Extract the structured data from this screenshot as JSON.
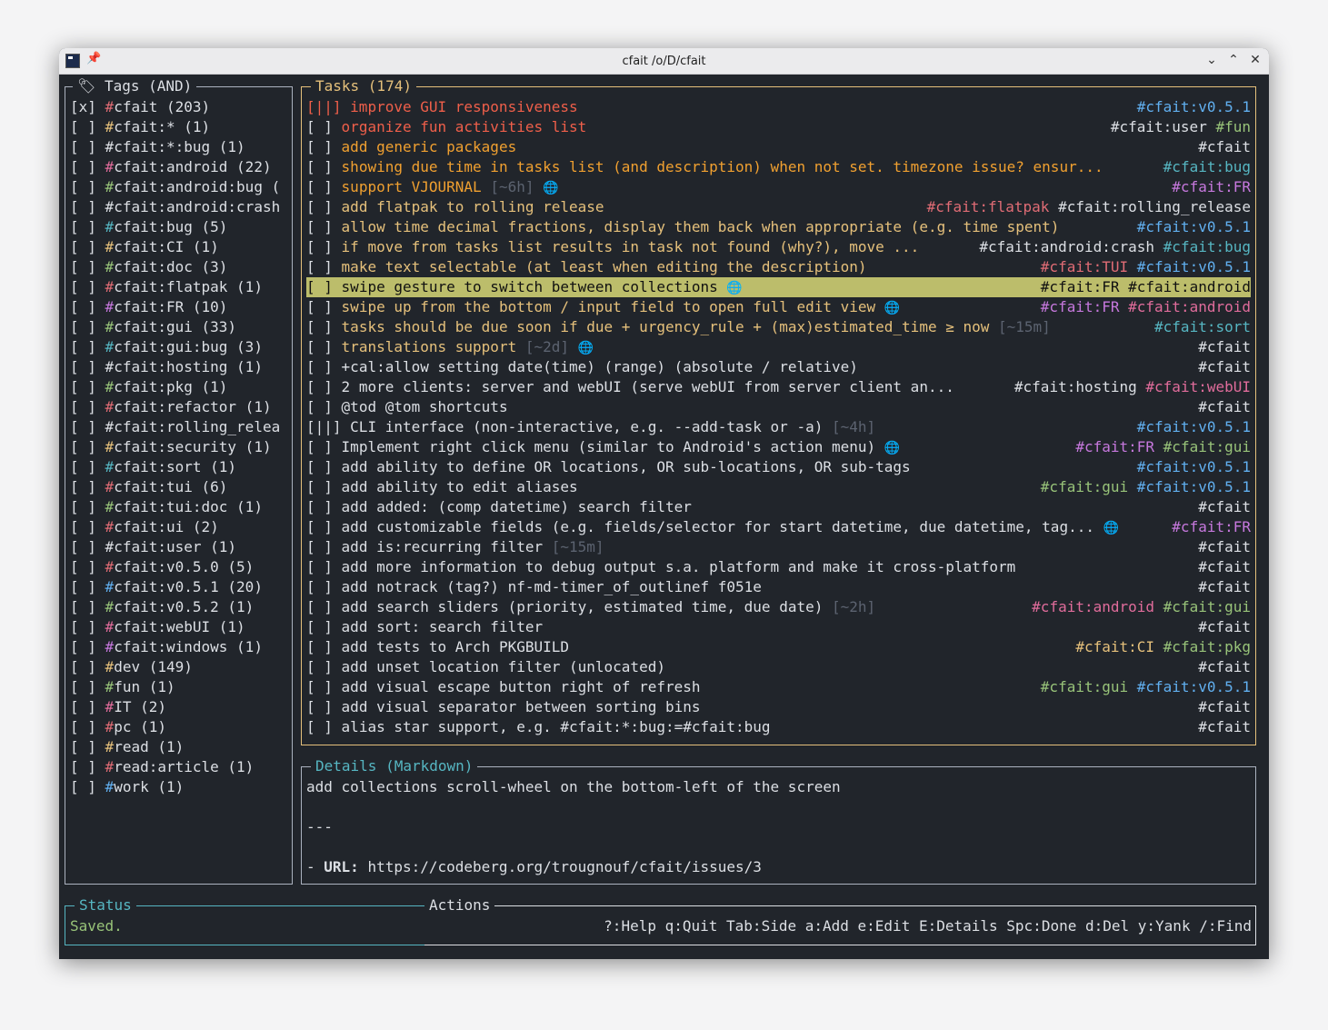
{
  "window": {
    "title": "cfait /o/D/cfait"
  },
  "colors": {
    "bg": "#21252b",
    "border_active": "#e5c07b",
    "border": "#abb2bf",
    "title_accent": "#e5c07b",
    "details_title": "#56b6c2",
    "text": "#dcdfe4",
    "dim": "#5c6370",
    "red": "#ef5f4a",
    "orange": "#f0a030",
    "yellow": "#e5c07b",
    "blue": "#61afef",
    "purple": "#c678dd",
    "pink": "#e06cd7",
    "green": "#98c379",
    "cyan": "#56b6c2",
    "magenta": "#e06c9b",
    "selected": "#bcbd6b"
  },
  "tags_panel": {
    "title": "Tags (AND)",
    "items": [
      {
        "check": "[x]",
        "hash": "#",
        "name": "cfait (203)",
        "color": "#e06c75"
      },
      {
        "check": "[ ]",
        "hash": "#",
        "name": "cfait:* (1)",
        "color": "#e5c07b"
      },
      {
        "check": "[ ]",
        "hash": "#",
        "name": "cfait:*:bug (1)",
        "color": "#dcdfe4"
      },
      {
        "check": "[ ]",
        "hash": "#",
        "name": "cfait:android (22)",
        "color": "#e06c9b"
      },
      {
        "check": "[ ]",
        "hash": "#",
        "name": "cfait:android:bug (",
        "color": "#98c379"
      },
      {
        "check": "[ ]",
        "hash": "#",
        "name": "cfait:android:crash",
        "color": "#dcdfe4"
      },
      {
        "check": "[ ]",
        "hash": "#",
        "name": "cfait:bug (5)",
        "color": "#56b6c2"
      },
      {
        "check": "[ ]",
        "hash": "#",
        "name": "cfait:CI (1)",
        "color": "#e5c07b"
      },
      {
        "check": "[ ]",
        "hash": "#",
        "name": "cfait:doc (3)",
        "color": "#98c379"
      },
      {
        "check": "[ ]",
        "hash": "#",
        "name": "cfait:flatpak (1)",
        "color": "#e06c75"
      },
      {
        "check": "[ ]",
        "hash": "#",
        "name": "cfait:FR (10)",
        "color": "#c678dd"
      },
      {
        "check": "[ ]",
        "hash": "#",
        "name": "cfait:gui (33)",
        "color": "#98c379"
      },
      {
        "check": "[ ]",
        "hash": "#",
        "name": "cfait:gui:bug (3)",
        "color": "#56b6c2"
      },
      {
        "check": "[ ]",
        "hash": "#",
        "name": "cfait:hosting (1)",
        "color": "#dcdfe4"
      },
      {
        "check": "[ ]",
        "hash": "#",
        "name": "cfait:pkg (1)",
        "color": "#98c379"
      },
      {
        "check": "[ ]",
        "hash": "#",
        "name": "cfait:refactor (1)",
        "color": "#e06c75"
      },
      {
        "check": "[ ]",
        "hash": "#",
        "name": "cfait:rolling_relea",
        "color": "#dcdfe4"
      },
      {
        "check": "[ ]",
        "hash": "#",
        "name": "cfait:security (1)",
        "color": "#e5c07b"
      },
      {
        "check": "[ ]",
        "hash": "#",
        "name": "cfait:sort (1)",
        "color": "#56b6c2"
      },
      {
        "check": "[ ]",
        "hash": "#",
        "name": "cfait:tui (6)",
        "color": "#e06c75"
      },
      {
        "check": "[ ]",
        "hash": "#",
        "name": "cfait:tui:doc (1)",
        "color": "#98c379"
      },
      {
        "check": "[ ]",
        "hash": "#",
        "name": "cfait:ui (2)",
        "color": "#e06c75"
      },
      {
        "check": "[ ]",
        "hash": "#",
        "name": "cfait:user (1)",
        "color": "#dcdfe4"
      },
      {
        "check": "[ ]",
        "hash": "#",
        "name": "cfait:v0.5.0 (5)",
        "color": "#e06c75"
      },
      {
        "check": "[ ]",
        "hash": "#",
        "name": "cfait:v0.5.1 (20)",
        "color": "#61afef"
      },
      {
        "check": "[ ]",
        "hash": "#",
        "name": "cfait:v0.5.2 (1)",
        "color": "#98c379"
      },
      {
        "check": "[ ]",
        "hash": "#",
        "name": "cfait:webUI (1)",
        "color": "#e06c9b"
      },
      {
        "check": "[ ]",
        "hash": "#",
        "name": "cfait:windows (1)",
        "color": "#c678dd"
      },
      {
        "check": "[ ]",
        "hash": "#",
        "name": "dev (149)",
        "color": "#e5c07b"
      },
      {
        "check": "[ ]",
        "hash": "#",
        "name": "fun (1)",
        "color": "#98c379"
      },
      {
        "check": "[ ]",
        "hash": "#",
        "name": "IT (2)",
        "color": "#e06c9b"
      },
      {
        "check": "[ ]",
        "hash": "#",
        "name": "pc (1)",
        "color": "#e06c75"
      },
      {
        "check": "[ ]",
        "hash": "#",
        "name": "read (1)",
        "color": "#e5c07b"
      },
      {
        "check": "[ ]",
        "hash": "#",
        "name": "read:article (1)",
        "color": "#e06c75"
      },
      {
        "check": "[ ]",
        "hash": "#",
        "name": "work (1)",
        "color": "#61afef"
      }
    ]
  },
  "tasks_panel": {
    "title": "Tasks (174)",
    "items": [
      {
        "check": "[||]",
        "text": "improve GUI responsiveness",
        "color": "#ef5f4a",
        "tags": [
          {
            "t": "#cfait:v0.5.1",
            "c": "#61afef"
          }
        ]
      },
      {
        "check": "[ ]",
        "text": "organize fun activities list",
        "color": "#ef5f4a",
        "tags": [
          {
            "t": "#cfait:user",
            "c": "#dcdfe4"
          },
          {
            "t": "#fun",
            "c": "#98c379"
          }
        ]
      },
      {
        "check": "[ ]",
        "text": "add generic packages",
        "color": "#f0a030",
        "tags": [
          {
            "t": "#cfait",
            "c": "#dcdfe4"
          }
        ]
      },
      {
        "check": "[ ]",
        "text": "showing due time in tasks list (and description) when not set. timezone issue? ensur...",
        "color": "#f0a030",
        "tags": [
          {
            "t": "#cfait:bug",
            "c": "#56b6c2"
          }
        ]
      },
      {
        "check": "[ ]",
        "text": "support VJOURNAL",
        "color": "#f0a030",
        "est": "[~6h]",
        "globe": true,
        "tags": [
          {
            "t": "#cfait:FR",
            "c": "#c678dd"
          }
        ]
      },
      {
        "check": "[ ]",
        "text": "add flatpak to rolling release",
        "color": "#e5c07b",
        "tags": [
          {
            "t": "#cfait:flatpak",
            "c": "#e06c75"
          },
          {
            "t": "#cfait:rolling_release",
            "c": "#dcdfe4"
          }
        ]
      },
      {
        "check": "[ ]",
        "text": "allow time decimal fractions, display them back when appropriate (e.g. time spent)",
        "color": "#e5c07b",
        "tags": [
          {
            "t": "#cfait:v0.5.1",
            "c": "#61afef"
          }
        ]
      },
      {
        "check": "[ ]",
        "text": "if move from tasks list results in task not found (why?), move ...",
        "color": "#e5c07b",
        "tags": [
          {
            "t": "#cfait:android:crash",
            "c": "#dcdfe4"
          },
          {
            "t": "#cfait:bug",
            "c": "#56b6c2"
          }
        ]
      },
      {
        "check": "[ ]",
        "text": "make text selectable (at least when editing the description)",
        "color": "#e5c07b",
        "tags": [
          {
            "t": "#cfait:TUI",
            "c": "#e06c75"
          },
          {
            "t": "#cfait:v0.5.1",
            "c": "#61afef"
          }
        ]
      },
      {
        "check": "[ ]",
        "text": "swipe gesture to switch between collections",
        "color": "#111111",
        "globe": true,
        "selected": true,
        "tags": [
          {
            "t": "#cfait:FR",
            "c": "#111111"
          },
          {
            "t": "#cfait:android",
            "c": "#111111"
          }
        ]
      },
      {
        "check": "[ ]",
        "text": "swipe up from the bottom / input field to open full edit view",
        "color": "#e5c07b",
        "globe": true,
        "tags": [
          {
            "t": "#cfait:FR",
            "c": "#c678dd"
          },
          {
            "t": "#cfait:android",
            "c": "#e06c9b"
          }
        ]
      },
      {
        "check": "[ ]",
        "text": "tasks should be due soon if due + urgency_rule + (max)estimated_time ≥ now",
        "color": "#e5c07b",
        "est": "[~15m]",
        "tags": [
          {
            "t": "#cfait:sort",
            "c": "#56b6c2"
          }
        ]
      },
      {
        "check": "[ ]",
        "text": "translations support",
        "color": "#e5c07b",
        "est": "[~2d]",
        "globe": true,
        "tags": [
          {
            "t": "#cfait",
            "c": "#dcdfe4"
          }
        ]
      },
      {
        "check": "[ ]",
        "text": "+cal:allow setting date(time) (range) (absolute / relative)",
        "color": "#dcdfe4",
        "tags": [
          {
            "t": "#cfait",
            "c": "#dcdfe4"
          }
        ]
      },
      {
        "check": "[ ]",
        "text": "2 more clients: server and webUI (serve webUI from server client an...",
        "color": "#dcdfe4",
        "tags": [
          {
            "t": "#cfait:hosting",
            "c": "#dcdfe4"
          },
          {
            "t": "#cfait:webUI",
            "c": "#e06c9b"
          }
        ]
      },
      {
        "check": "[ ]",
        "text": "@tod @tom shortcuts",
        "color": "#dcdfe4",
        "tags": [
          {
            "t": "#cfait",
            "c": "#dcdfe4"
          }
        ]
      },
      {
        "check": "[||]",
        "text": "CLI interface (non-interactive, e.g. --add-task or -a)",
        "color": "#dcdfe4",
        "est": "[~4h]",
        "tags": [
          {
            "t": "#cfait:v0.5.1",
            "c": "#61afef"
          }
        ]
      },
      {
        "check": "[ ]",
        "text": "Implement right click menu (similar to Android's action menu)",
        "color": "#dcdfe4",
        "globe": true,
        "tags": [
          {
            "t": "#cfait:FR",
            "c": "#c678dd"
          },
          {
            "t": "#cfait:gui",
            "c": "#98c379"
          }
        ]
      },
      {
        "check": "[ ]",
        "text": "add ability to define OR locations, OR sub-locations, OR sub-tags",
        "color": "#dcdfe4",
        "tags": [
          {
            "t": "#cfait:v0.5.1",
            "c": "#61afef"
          }
        ]
      },
      {
        "check": "[ ]",
        "text": "add ability to edit aliases",
        "color": "#dcdfe4",
        "tags": [
          {
            "t": "#cfait:gui",
            "c": "#98c379"
          },
          {
            "t": "#cfait:v0.5.1",
            "c": "#61afef"
          }
        ]
      },
      {
        "check": "[ ]",
        "text": "add added: (comp datetime) search filter",
        "color": "#dcdfe4",
        "tags": [
          {
            "t": "#cfait",
            "c": "#dcdfe4"
          }
        ]
      },
      {
        "check": "[ ]",
        "text": "add customizable fields (e.g. fields/selector for start datetime, due datetime, tag...",
        "color": "#dcdfe4",
        "globe": true,
        "tags": [
          {
            "t": "#cfait:FR",
            "c": "#c678dd"
          }
        ]
      },
      {
        "check": "[ ]",
        "text": "add is:recurring filter",
        "color": "#dcdfe4",
        "est": "[~15m]",
        "tags": [
          {
            "t": "#cfait",
            "c": "#dcdfe4"
          }
        ]
      },
      {
        "check": "[ ]",
        "text": "add more information to debug output s.a. platform and make it cross-platform",
        "color": "#dcdfe4",
        "tags": [
          {
            "t": "#cfait",
            "c": "#dcdfe4"
          }
        ]
      },
      {
        "check": "[ ]",
        "text": "add notrack (tag?) nf-md-timer_of_outlinef f051e",
        "color": "#dcdfe4",
        "tags": [
          {
            "t": "#cfait",
            "c": "#dcdfe4"
          }
        ]
      },
      {
        "check": "[ ]",
        "text": "add search sliders (priority, estimated time, due date)",
        "color": "#dcdfe4",
        "est": "[~2h]",
        "tags": [
          {
            "t": "#cfait:android",
            "c": "#e06c9b"
          },
          {
            "t": "#cfait:gui",
            "c": "#98c379"
          }
        ]
      },
      {
        "check": "[ ]",
        "text": "add sort: search filter",
        "color": "#dcdfe4",
        "tags": [
          {
            "t": "#cfait",
            "c": "#dcdfe4"
          }
        ]
      },
      {
        "check": "[ ]",
        "text": "add tests to Arch PKGBUILD",
        "color": "#dcdfe4",
        "tags": [
          {
            "t": "#cfait:CI",
            "c": "#e5c07b"
          },
          {
            "t": "#cfait:pkg",
            "c": "#98c379"
          }
        ]
      },
      {
        "check": "[ ]",
        "text": "add unset location filter (unlocated)",
        "color": "#dcdfe4",
        "tags": [
          {
            "t": "#cfait",
            "c": "#dcdfe4"
          }
        ]
      },
      {
        "check": "[ ]",
        "text": "add visual escape button right of refresh",
        "color": "#dcdfe4",
        "tags": [
          {
            "t": "#cfait:gui",
            "c": "#98c379"
          },
          {
            "t": "#cfait:v0.5.1",
            "c": "#61afef"
          }
        ]
      },
      {
        "check": "[ ]",
        "text": "add visual separator between sorting bins",
        "color": "#dcdfe4",
        "tags": [
          {
            "t": "#cfait",
            "c": "#dcdfe4"
          }
        ]
      },
      {
        "check": "[ ]",
        "text": "alias star support, e.g. #cfait:*:bug:=#cfait:bug",
        "color": "#dcdfe4",
        "tags": [
          {
            "t": "#cfait",
            "c": "#dcdfe4"
          }
        ]
      }
    ]
  },
  "details_panel": {
    "title": "Details (Markdown)",
    "line1": "add collections scroll-wheel on the bottom-left of the screen",
    "separator": "---",
    "url_prefix": "- ",
    "url_label": "URL:",
    "url": "https://codeberg.org/trougnouf/cfait/issues/3"
  },
  "status_panel": {
    "title": "Status",
    "text": "Saved."
  },
  "actions_panel": {
    "title": "Actions",
    "text": "?:Help q:Quit Tab:Side a:Add e:Edit E:Details Spc:Done d:Del y:Yank /:Find"
  }
}
